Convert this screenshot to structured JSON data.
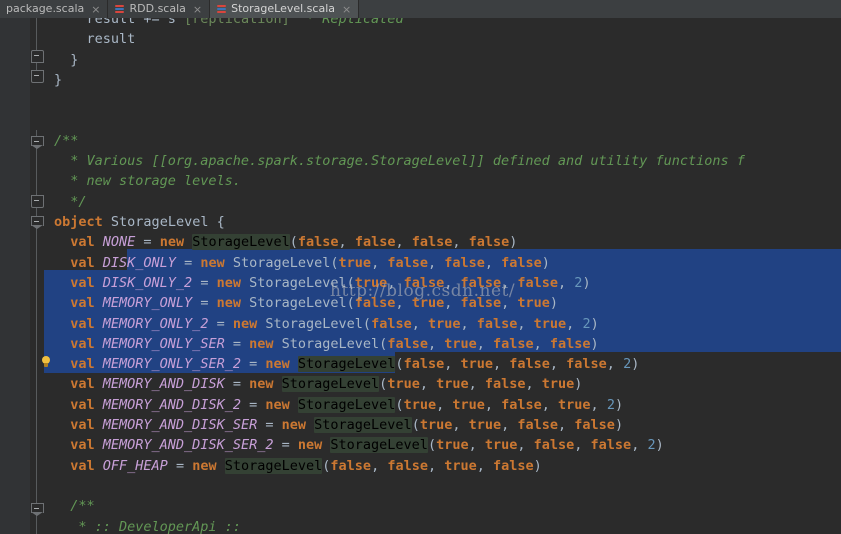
{
  "window": {
    "app": "IntelliJ IDEA",
    "file_type": "scala"
  },
  "tabs": [
    {
      "label": "package.scala",
      "icon": "scala-file-icon",
      "close": "×",
      "active": false
    },
    {
      "label": "RDD.scala",
      "icon": "scala-file-icon",
      "close": "×",
      "active": false
    },
    {
      "label": "StorageLevel.scala",
      "icon": "scala-file-icon",
      "close": "×",
      "active": true
    }
  ],
  "watermark": "http://blog.csdn.net/",
  "colors": {
    "editor_background": "#2b2b2b",
    "gutter_background": "#313335",
    "tab_background": "#3c3f41",
    "tab_active_background": "#4e5254",
    "selection": "#214283",
    "keyword": "#cc7832",
    "identifier": "#a9b7c6",
    "field": "#c8a0d8",
    "number": "#6897bb",
    "comment": "#629755",
    "occurrence_highlight": "#344134"
  },
  "gutter": {
    "fold_markers": [
      "fold-collapse-brace",
      "fold-collapse-brace",
      "fold-collapse-comment",
      "fold-collapse-comment-end",
      "fold-collapse-object",
      "fold-collapse-comment2"
    ],
    "intention_bulb": "lightbulb-icon"
  },
  "code": {
    "lines": [
      {
        "indent": 4,
        "clipped_top": true,
        "tokens": [
          {
            "t": "result += s",
            "c": "ident"
          },
          {
            "t": "\"[replication]\"",
            "c": "str"
          },
          {
            "t": " * Replicated",
            "c": "cmt"
          }
        ]
      },
      {
        "indent": 4,
        "tokens": [
          {
            "t": "result",
            "c": "ident"
          }
        ]
      },
      {
        "indent": 2,
        "tokens": [
          {
            "t": "}",
            "c": "punc"
          }
        ]
      },
      {
        "indent": 0,
        "tokens": [
          {
            "t": "}",
            "c": "punc"
          }
        ]
      },
      {
        "indent": 0,
        "tokens": []
      },
      {
        "indent": 0,
        "tokens": []
      },
      {
        "indent": 0,
        "tokens": [
          {
            "t": "/**",
            "c": "cmt"
          }
        ]
      },
      {
        "indent": 1,
        "tokens": [
          {
            "t": " * Various [[org.apache.spark.storage.StorageLevel]] defined and utility functions f",
            "c": "cmt"
          }
        ]
      },
      {
        "indent": 1,
        "tokens": [
          {
            "t": " * new storage levels.",
            "c": "cmt"
          }
        ]
      },
      {
        "indent": 1,
        "tokens": [
          {
            "t": " */",
            "c": "cmt"
          }
        ]
      },
      {
        "indent": 0,
        "tokens": [
          {
            "t": "object",
            "c": "kw"
          },
          {
            "t": " ",
            "c": "punc"
          },
          {
            "t": "StorageLevel",
            "c": "cls"
          },
          {
            "t": " {",
            "c": "punc"
          }
        ]
      },
      {
        "indent": 2,
        "tokens": [
          {
            "t": "val",
            "c": "kw"
          },
          {
            "t": " ",
            "c": "punc"
          },
          {
            "t": "NONE",
            "c": "field"
          },
          {
            "t": " = ",
            "c": "punc"
          },
          {
            "t": "new",
            "c": "kw"
          },
          {
            "t": " ",
            "c": "punc"
          },
          {
            "t": "StorageLevel",
            "c": "occ"
          },
          {
            "t": "(",
            "c": "punc"
          },
          {
            "t": "false",
            "c": "kw"
          },
          {
            "t": ", ",
            "c": "punc"
          },
          {
            "t": "false",
            "c": "kw"
          },
          {
            "t": ", ",
            "c": "punc"
          },
          {
            "t": "false",
            "c": "kw"
          },
          {
            "t": ", ",
            "c": "punc"
          },
          {
            "t": "false",
            "c": "kw"
          },
          {
            "t": ")",
            "c": "punc"
          }
        ]
      },
      {
        "indent": 2,
        "tokens": [
          {
            "t": "val",
            "c": "kw"
          },
          {
            "t": " ",
            "c": "punc"
          },
          {
            "t": "DISK_ONLY",
            "c": "field"
          },
          {
            "t": " = ",
            "c": "punc"
          },
          {
            "t": "new",
            "c": "kw"
          },
          {
            "t": " ",
            "c": "punc"
          },
          {
            "t": "StorageLevel",
            "c": "cls"
          },
          {
            "t": "(",
            "c": "punc"
          },
          {
            "t": "true",
            "c": "kw"
          },
          {
            "t": ", ",
            "c": "punc"
          },
          {
            "t": "false",
            "c": "kw"
          },
          {
            "t": ", ",
            "c": "punc"
          },
          {
            "t": "false",
            "c": "kw"
          },
          {
            "t": ", ",
            "c": "punc"
          },
          {
            "t": "false",
            "c": "kw"
          },
          {
            "t": ")",
            "c": "punc"
          }
        ]
      },
      {
        "indent": 2,
        "tokens": [
          {
            "t": "val",
            "c": "kw"
          },
          {
            "t": " ",
            "c": "punc"
          },
          {
            "t": "DISK_ONLY_2",
            "c": "field"
          },
          {
            "t": " = ",
            "c": "punc"
          },
          {
            "t": "new",
            "c": "kw"
          },
          {
            "t": " ",
            "c": "punc"
          },
          {
            "t": "StorageLevel",
            "c": "cls"
          },
          {
            "t": "(",
            "c": "punc"
          },
          {
            "t": "true",
            "c": "kw"
          },
          {
            "t": ", ",
            "c": "punc"
          },
          {
            "t": "false",
            "c": "kw"
          },
          {
            "t": ", ",
            "c": "punc"
          },
          {
            "t": "false",
            "c": "kw"
          },
          {
            "t": ", ",
            "c": "punc"
          },
          {
            "t": "false",
            "c": "kw"
          },
          {
            "t": ", ",
            "c": "punc"
          },
          {
            "t": "2",
            "c": "num"
          },
          {
            "t": ")",
            "c": "punc"
          }
        ]
      },
      {
        "indent": 2,
        "tokens": [
          {
            "t": "val",
            "c": "kw"
          },
          {
            "t": " ",
            "c": "punc"
          },
          {
            "t": "MEMORY_ONLY",
            "c": "field"
          },
          {
            "t": " = ",
            "c": "punc"
          },
          {
            "t": "new",
            "c": "kw"
          },
          {
            "t": " ",
            "c": "punc"
          },
          {
            "t": "StorageLevel",
            "c": "cls"
          },
          {
            "t": "(",
            "c": "punc"
          },
          {
            "t": "false",
            "c": "kw"
          },
          {
            "t": ", ",
            "c": "punc"
          },
          {
            "t": "true",
            "c": "kw"
          },
          {
            "t": ", ",
            "c": "punc"
          },
          {
            "t": "false",
            "c": "kw"
          },
          {
            "t": ", ",
            "c": "punc"
          },
          {
            "t": "true",
            "c": "kw"
          },
          {
            "t": ")",
            "c": "punc"
          }
        ]
      },
      {
        "indent": 2,
        "tokens": [
          {
            "t": "val",
            "c": "kw"
          },
          {
            "t": " ",
            "c": "punc"
          },
          {
            "t": "MEMORY_ONLY_2",
            "c": "field"
          },
          {
            "t": " = ",
            "c": "punc"
          },
          {
            "t": "new",
            "c": "kw"
          },
          {
            "t": " ",
            "c": "punc"
          },
          {
            "t": "StorageLevel",
            "c": "cls"
          },
          {
            "t": "(",
            "c": "punc"
          },
          {
            "t": "false",
            "c": "kw"
          },
          {
            "t": ", ",
            "c": "punc"
          },
          {
            "t": "true",
            "c": "kw"
          },
          {
            "t": ", ",
            "c": "punc"
          },
          {
            "t": "false",
            "c": "kw"
          },
          {
            "t": ", ",
            "c": "punc"
          },
          {
            "t": "true",
            "c": "kw"
          },
          {
            "t": ", ",
            "c": "punc"
          },
          {
            "t": "2",
            "c": "num"
          },
          {
            "t": ")",
            "c": "punc"
          }
        ]
      },
      {
        "indent": 2,
        "tokens": [
          {
            "t": "val",
            "c": "kw"
          },
          {
            "t": " ",
            "c": "punc"
          },
          {
            "t": "MEMORY_ONLY_SER",
            "c": "field"
          },
          {
            "t": " = ",
            "c": "punc"
          },
          {
            "t": "new",
            "c": "kw"
          },
          {
            "t": " ",
            "c": "punc"
          },
          {
            "t": "StorageLevel",
            "c": "cls"
          },
          {
            "t": "(",
            "c": "punc"
          },
          {
            "t": "false",
            "c": "kw"
          },
          {
            "t": ", ",
            "c": "punc"
          },
          {
            "t": "true",
            "c": "kw"
          },
          {
            "t": ", ",
            "c": "punc"
          },
          {
            "t": "false",
            "c": "kw"
          },
          {
            "t": ", ",
            "c": "punc"
          },
          {
            "t": "false",
            "c": "kw"
          },
          {
            "t": ")",
            "c": "punc"
          }
        ]
      },
      {
        "indent": 2,
        "tokens": [
          {
            "t": "val",
            "c": "kw"
          },
          {
            "t": " ",
            "c": "punc"
          },
          {
            "t": "MEMORY_ONLY_SER_2",
            "c": "field"
          },
          {
            "t": " = ",
            "c": "punc"
          },
          {
            "t": "new",
            "c": "kw"
          },
          {
            "t": " ",
            "c": "punc"
          },
          {
            "t": "StorageLevel",
            "c": "occ"
          },
          {
            "t": "(",
            "c": "punc"
          },
          {
            "t": "false",
            "c": "kw"
          },
          {
            "t": ", ",
            "c": "punc"
          },
          {
            "t": "true",
            "c": "kw"
          },
          {
            "t": ", ",
            "c": "punc"
          },
          {
            "t": "false",
            "c": "kw"
          },
          {
            "t": ", ",
            "c": "punc"
          },
          {
            "t": "false",
            "c": "kw"
          },
          {
            "t": ", ",
            "c": "punc"
          },
          {
            "t": "2",
            "c": "num"
          },
          {
            "t": ")",
            "c": "punc"
          }
        ]
      },
      {
        "indent": 2,
        "tokens": [
          {
            "t": "val",
            "c": "kw"
          },
          {
            "t": " ",
            "c": "punc"
          },
          {
            "t": "MEMORY_AND_DISK",
            "c": "field"
          },
          {
            "t": " = ",
            "c": "punc"
          },
          {
            "t": "new",
            "c": "kw"
          },
          {
            "t": " ",
            "c": "punc"
          },
          {
            "t": "StorageLevel",
            "c": "occ"
          },
          {
            "t": "(",
            "c": "punc"
          },
          {
            "t": "true",
            "c": "kw"
          },
          {
            "t": ", ",
            "c": "punc"
          },
          {
            "t": "true",
            "c": "kw"
          },
          {
            "t": ", ",
            "c": "punc"
          },
          {
            "t": "false",
            "c": "kw"
          },
          {
            "t": ", ",
            "c": "punc"
          },
          {
            "t": "true",
            "c": "kw"
          },
          {
            "t": ")",
            "c": "punc"
          }
        ]
      },
      {
        "indent": 2,
        "tokens": [
          {
            "t": "val",
            "c": "kw"
          },
          {
            "t": " ",
            "c": "punc"
          },
          {
            "t": "MEMORY_AND_DISK_2",
            "c": "field"
          },
          {
            "t": " = ",
            "c": "punc"
          },
          {
            "t": "new",
            "c": "kw"
          },
          {
            "t": " ",
            "c": "punc"
          },
          {
            "t": "StorageLevel",
            "c": "occ"
          },
          {
            "t": "(",
            "c": "punc"
          },
          {
            "t": "true",
            "c": "kw"
          },
          {
            "t": ", ",
            "c": "punc"
          },
          {
            "t": "true",
            "c": "kw"
          },
          {
            "t": ", ",
            "c": "punc"
          },
          {
            "t": "false",
            "c": "kw"
          },
          {
            "t": ", ",
            "c": "punc"
          },
          {
            "t": "true",
            "c": "kw"
          },
          {
            "t": ", ",
            "c": "punc"
          },
          {
            "t": "2",
            "c": "num"
          },
          {
            "t": ")",
            "c": "punc"
          }
        ]
      },
      {
        "indent": 2,
        "tokens": [
          {
            "t": "val",
            "c": "kw"
          },
          {
            "t": " ",
            "c": "punc"
          },
          {
            "t": "MEMORY_AND_DISK_SER",
            "c": "field"
          },
          {
            "t": " = ",
            "c": "punc"
          },
          {
            "t": "new",
            "c": "kw"
          },
          {
            "t": " ",
            "c": "punc"
          },
          {
            "t": "StorageLevel",
            "c": "occ"
          },
          {
            "t": "(",
            "c": "punc"
          },
          {
            "t": "true",
            "c": "kw"
          },
          {
            "t": ", ",
            "c": "punc"
          },
          {
            "t": "true",
            "c": "kw"
          },
          {
            "t": ", ",
            "c": "punc"
          },
          {
            "t": "false",
            "c": "kw"
          },
          {
            "t": ", ",
            "c": "punc"
          },
          {
            "t": "false",
            "c": "kw"
          },
          {
            "t": ")",
            "c": "punc"
          }
        ]
      },
      {
        "indent": 2,
        "tokens": [
          {
            "t": "val",
            "c": "kw"
          },
          {
            "t": " ",
            "c": "punc"
          },
          {
            "t": "MEMORY_AND_DISK_SER_2",
            "c": "field"
          },
          {
            "t": " = ",
            "c": "punc"
          },
          {
            "t": "new",
            "c": "kw"
          },
          {
            "t": " ",
            "c": "punc"
          },
          {
            "t": "StorageLevel",
            "c": "occ"
          },
          {
            "t": "(",
            "c": "punc"
          },
          {
            "t": "true",
            "c": "kw"
          },
          {
            "t": ", ",
            "c": "punc"
          },
          {
            "t": "true",
            "c": "kw"
          },
          {
            "t": ", ",
            "c": "punc"
          },
          {
            "t": "false",
            "c": "kw"
          },
          {
            "t": ", ",
            "c": "punc"
          },
          {
            "t": "false",
            "c": "kw"
          },
          {
            "t": ", ",
            "c": "punc"
          },
          {
            "t": "2",
            "c": "num"
          },
          {
            "t": ")",
            "c": "punc"
          }
        ]
      },
      {
        "indent": 2,
        "tokens": [
          {
            "t": "val",
            "c": "kw"
          },
          {
            "t": " ",
            "c": "punc"
          },
          {
            "t": "OFF_HEAP",
            "c": "field"
          },
          {
            "t": " = ",
            "c": "punc"
          },
          {
            "t": "new",
            "c": "kw"
          },
          {
            "t": " ",
            "c": "punc"
          },
          {
            "t": "StorageLevel",
            "c": "occ"
          },
          {
            "t": "(",
            "c": "punc"
          },
          {
            "t": "false",
            "c": "kw"
          },
          {
            "t": ", ",
            "c": "punc"
          },
          {
            "t": "false",
            "c": "kw"
          },
          {
            "t": ", ",
            "c": "punc"
          },
          {
            "t": "true",
            "c": "kw"
          },
          {
            "t": ", ",
            "c": "punc"
          },
          {
            "t": "false",
            "c": "kw"
          },
          {
            "t": ")",
            "c": "punc"
          }
        ]
      },
      {
        "indent": 0,
        "tokens": []
      },
      {
        "indent": 2,
        "tokens": [
          {
            "t": "/**",
            "c": "cmt"
          }
        ]
      },
      {
        "indent": 2,
        "clipped_bottom": true,
        "tokens": [
          {
            "t": " * :: DeveloperApi ::",
            "c": "cmt"
          }
        ]
      }
    ]
  }
}
